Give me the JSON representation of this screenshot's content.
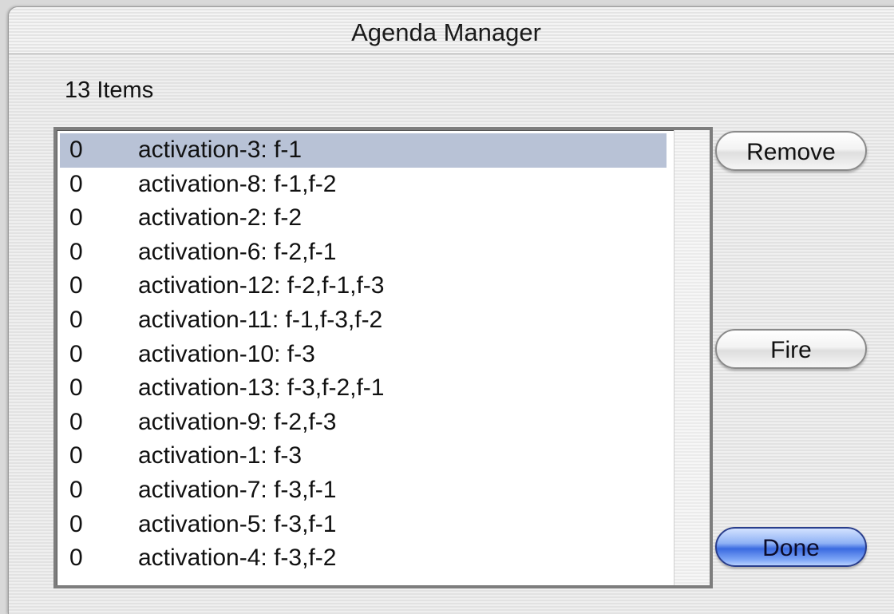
{
  "window": {
    "title": "Agenda Manager"
  },
  "agenda": {
    "count_label": "13 Items",
    "items": [
      {
        "salience": "0",
        "activation": "activation-3: f-1"
      },
      {
        "salience": "0",
        "activation": "activation-8: f-1,f-2"
      },
      {
        "salience": "0",
        "activation": "activation-2: f-2"
      },
      {
        "salience": "0",
        "activation": "activation-6: f-2,f-1"
      },
      {
        "salience": "0",
        "activation": "activation-12: f-2,f-1,f-3"
      },
      {
        "salience": "0",
        "activation": "activation-11: f-1,f-3,f-2"
      },
      {
        "salience": "0",
        "activation": "activation-10: f-3"
      },
      {
        "salience": "0",
        "activation": "activation-13: f-3,f-2,f-1"
      },
      {
        "salience": "0",
        "activation": "activation-9: f-2,f-3"
      },
      {
        "salience": "0",
        "activation": "activation-1: f-3"
      },
      {
        "salience": "0",
        "activation": "activation-7: f-3,f-1"
      },
      {
        "salience": "0",
        "activation": "activation-5: f-3,f-1"
      },
      {
        "salience": "0",
        "activation": "activation-4: f-3,f-2"
      }
    ]
  },
  "buttons": {
    "remove": "Remove",
    "fire": "Fire",
    "done": "Done"
  },
  "colors": {
    "selection": "#b8c2d6",
    "default_button": "#3a6ae0"
  }
}
